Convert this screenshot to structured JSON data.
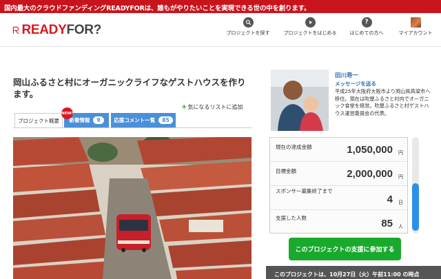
{
  "top_banner": {
    "text": "国内最大のクラウドファンディングREADYFORは、誰もがやりたいことを実現できる世の中を創ります。"
  },
  "header": {
    "logo_ready": "READY",
    "logo_for": "FOR?",
    "nav": [
      {
        "label": "プロジェクトを探す",
        "icon": "search-icon"
      },
      {
        "label": "プロジェクトをはじめる",
        "icon": "play-icon"
      },
      {
        "label": "はじめての方へ",
        "icon": "question-icon",
        "glyph": "?"
      },
      {
        "label": "マイアカウント",
        "icon": "avatar"
      }
    ]
  },
  "project": {
    "title": "岡山ふるさと村にオーガニックライフなゲストハウスを作ります。",
    "favorite_label": "気になるリストに追加",
    "tabs": [
      {
        "label": "プロジェクト概要"
      },
      {
        "label": "新着情報",
        "count": "9",
        "new_badge": "NEW!"
      },
      {
        "label": "応援コメント一覧",
        "count": "85"
      }
    ]
  },
  "owner": {
    "name": "田川寿一",
    "message_link": "メッセージを送る",
    "bio": "平成25年大阪府大阪市より岡山県高梁市へ移住。現在は吹屋ふるさと村内でオーガニック食堂を経営。吹屋ふるさと村ゲストハウス運営委員会の代表。"
  },
  "stats": [
    {
      "label": "現在の達成金額",
      "value": "1,050,000",
      "unit": "円"
    },
    {
      "label": "目標金額",
      "value": "2,000,000",
      "unit": "円"
    },
    {
      "label": "スポンサー募集終了まで",
      "value": "4",
      "unit": "日"
    },
    {
      "label": "支援した人数",
      "value": "85",
      "unit": "人"
    }
  ],
  "cta": {
    "support_label": "このプロジェクトの支援に参加する"
  },
  "deadline": {
    "text": "このプロジェクトは、10月27日（火）午前11:00 の時点"
  },
  "colors": {
    "brand_red": "#d8191f",
    "tab_blue": "#4a90d9",
    "cta_green": "#19a92c",
    "link_blue": "#2b6fb8"
  }
}
